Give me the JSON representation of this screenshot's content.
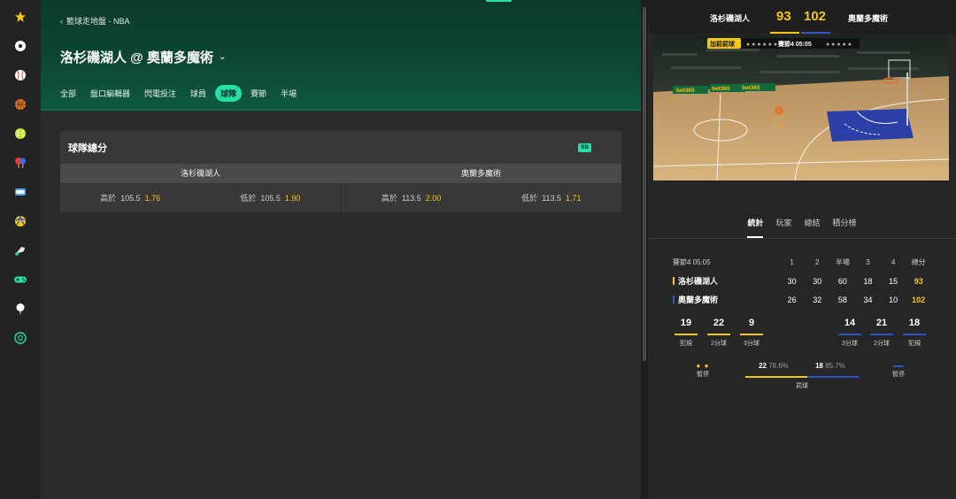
{
  "colors": {
    "accent": "#24e0a6",
    "gold": "#f5c518",
    "lakers": "#f5c518",
    "magic": "#2b56c9",
    "header": "#0d4634"
  },
  "nav": {
    "items": [
      {
        "name": "favorites-icon"
      },
      {
        "name": "soccer-icon"
      },
      {
        "name": "baseball-icon"
      },
      {
        "name": "basketball-icon"
      },
      {
        "name": "tennis-icon"
      },
      {
        "name": "table-tennis-icon"
      },
      {
        "name": "volleyball-icon"
      },
      {
        "name": "rugby-icon"
      },
      {
        "name": "badminton-icon"
      },
      {
        "name": "esports-icon"
      },
      {
        "name": "golf-icon"
      },
      {
        "name": "ball-icon"
      }
    ]
  },
  "header": {
    "breadcrumb_arrow": "‹",
    "breadcrumb": "籃球走地盤 - NBA",
    "title": "洛杉磯湖人 @ 奧蘭多魔術",
    "title_chevron": "⌄",
    "tabs": [
      "全部",
      "盤口編輯器",
      "閃電投注",
      "球員",
      "球隊",
      "賽節",
      "半場"
    ],
    "active_tab": "球隊"
  },
  "market": {
    "title": "球隊總分",
    "badge": "BB",
    "teams": [
      "洛杉磯湖人",
      "奧蘭多魔術"
    ],
    "odds": [
      [
        {
          "label": "高於",
          "line": "105.5",
          "price": "1.76"
        },
        {
          "label": "低於",
          "line": "105.5",
          "price": "1.90"
        }
      ],
      [
        {
          "label": "高於",
          "line": "113.5",
          "price": "2.00"
        },
        {
          "label": "低於",
          "line": "113.5",
          "price": "1.71"
        }
      ]
    ]
  },
  "scoreboard": {
    "home": "洛杉磯湖人",
    "home_score": "93",
    "away": "奧蘭多魔術",
    "away_score": "102"
  },
  "court": {
    "banner_tag": "加罰罰球",
    "quarter_clock": "賽節4  05:05",
    "ad_text": "bet365"
  },
  "stats_tabs": [
    "統計",
    "玩家",
    "總結",
    "積分榜"
  ],
  "score_table": {
    "header": [
      "賽節4  05:05",
      "1",
      "2",
      "半場",
      "3",
      "4",
      "總分"
    ],
    "rows": [
      {
        "team": "洛杉磯湖人",
        "vals": [
          "30",
          "30",
          "60",
          "18",
          "15",
          "93"
        ]
      },
      {
        "team": "奧蘭多魔術",
        "vals": [
          "26",
          "32",
          "58",
          "34",
          "10",
          "102"
        ]
      }
    ]
  },
  "team_stats": {
    "home": [
      {
        "value": "19",
        "label": "犯規"
      },
      {
        "value": "22",
        "label": "2分球"
      },
      {
        "value": "9",
        "label": "3分球"
      }
    ],
    "away": [
      {
        "value": "14",
        "label": "3分球"
      },
      {
        "value": "21",
        "label": "2分球"
      },
      {
        "value": "18",
        "label": "犯規"
      }
    ]
  },
  "timeouts": {
    "label": "暫停",
    "home_dots": "● ●"
  },
  "free_throws": {
    "home_value": "22",
    "home_pct": "78.6%",
    "away_value": "18",
    "away_pct": "85.7%",
    "label": "罰球",
    "home_share": 0.55
  }
}
